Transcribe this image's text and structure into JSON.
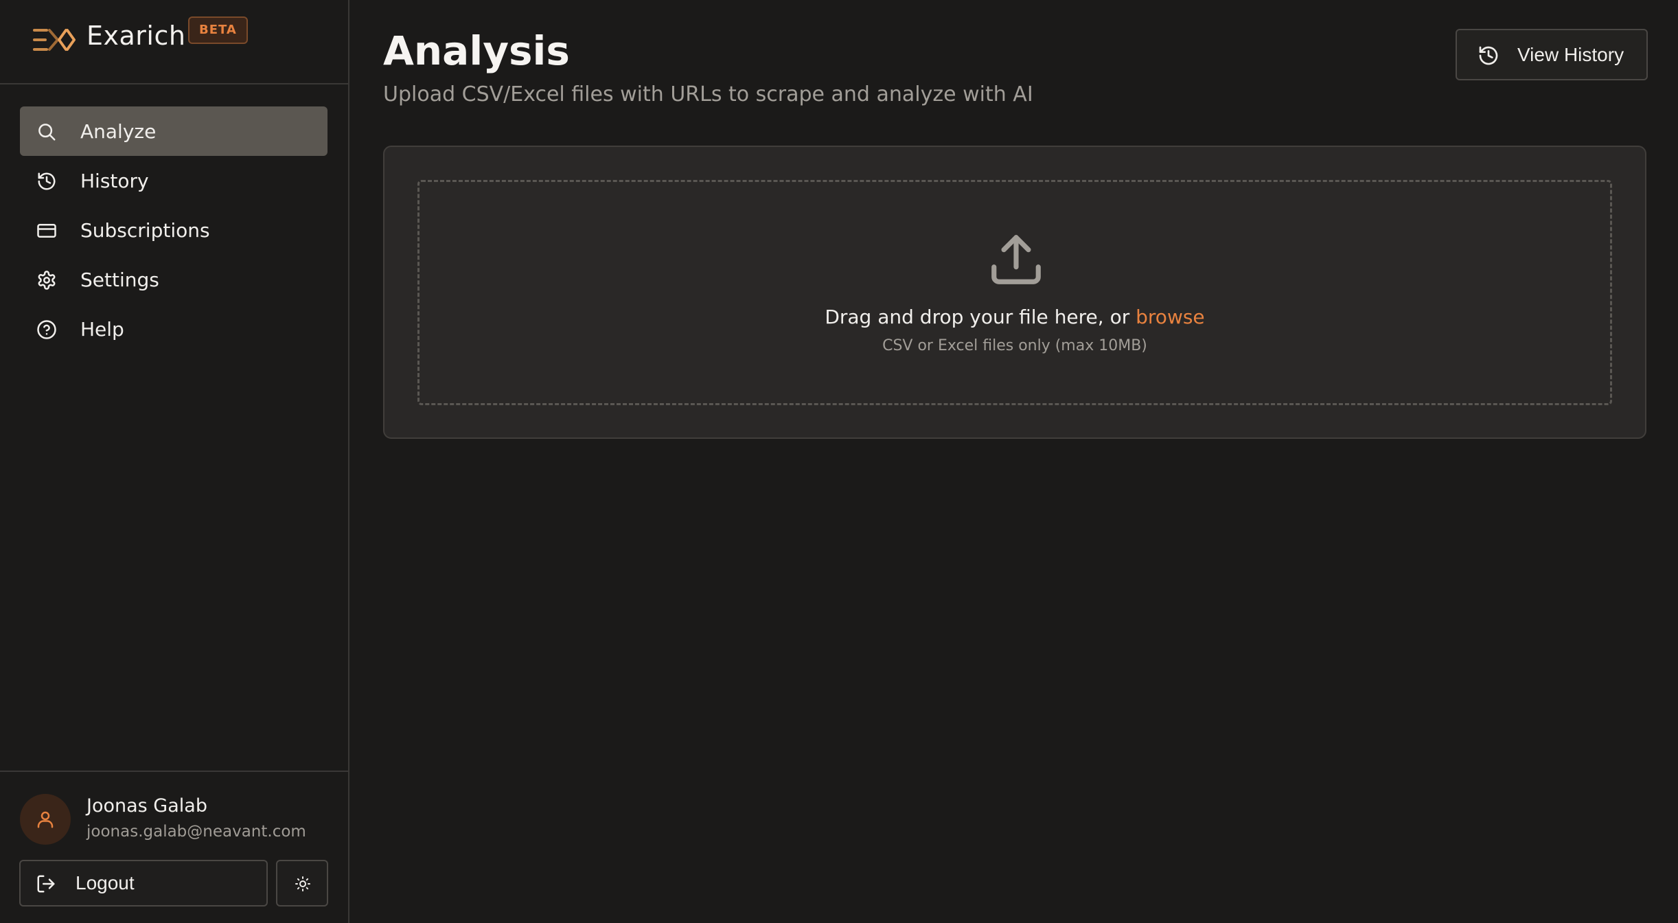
{
  "brand": {
    "name": "Exarich",
    "badge": "BETA"
  },
  "sidebar": {
    "items": [
      {
        "label": "Analyze",
        "icon": "search-icon",
        "active": true
      },
      {
        "label": "History",
        "icon": "history-icon",
        "active": false
      },
      {
        "label": "Subscriptions",
        "icon": "credit-card-icon",
        "active": false
      },
      {
        "label": "Settings",
        "icon": "gear-icon",
        "active": false
      },
      {
        "label": "Help",
        "icon": "help-circle-icon",
        "active": false
      }
    ]
  },
  "user": {
    "name": "Joonas Galab",
    "email": "joonas.galab@neavant.com",
    "logout_label": "Logout"
  },
  "main": {
    "title": "Analysis",
    "subtitle": "Upload CSV/Excel files with URLs to scrape and analyze with AI",
    "view_history_label": "View History",
    "dropzone": {
      "prompt": "Drag and drop your file here, or ",
      "browse_label": "browse",
      "hint": "CSV or Excel files only (max 10MB)"
    }
  },
  "colors": {
    "accent": "#e8823f",
    "background": "#1b1a19",
    "active_nav": "#5b5751"
  }
}
